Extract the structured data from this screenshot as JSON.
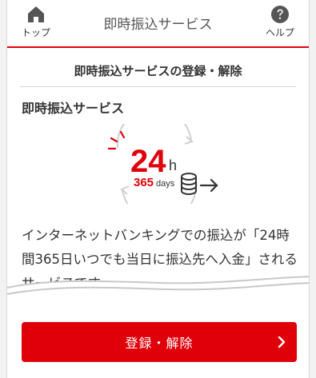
{
  "header": {
    "title": "即時振込サービス",
    "home_label": "トップ",
    "help_label": "ヘルプ",
    "home_icon": "home-icon",
    "help_icon": "question-circle-icon"
  },
  "main": {
    "page_title": "即時振込サービスの登録・解除",
    "section_title": "即時振込サービス",
    "illustration": {
      "hours_number": "24",
      "hours_unit": "h",
      "days_number": "365",
      "days_unit": "days",
      "icon": "coins-arrow-icon"
    },
    "description": "インターネットバンキングでの振込が「24時間365日いつでも当日に振込先へ入金」されるサービスです。"
  },
  "cta": {
    "label": "登録・解除",
    "icon": "chevron-right-icon"
  },
  "colors": {
    "accent": "#e0000a",
    "text": "#333333"
  }
}
